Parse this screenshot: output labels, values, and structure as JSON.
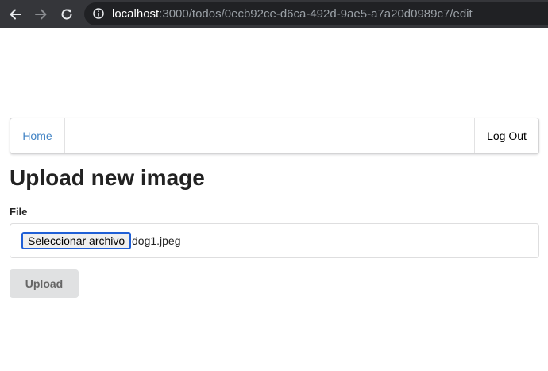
{
  "browser": {
    "url_host": "localhost",
    "url_path": ":3000/todos/0ecb92ce-d6ca-492d-9ae5-a7a20d0989c7/edit"
  },
  "navbar": {
    "home_label": "Home",
    "logout_label": "Log Out"
  },
  "page": {
    "title": "Upload new image"
  },
  "form": {
    "file_label": "File",
    "file_button_label": "Seleccionar archivo",
    "file_name": "dog1.jpeg",
    "submit_label": "Upload"
  },
  "colors": {
    "link": "#4183c4",
    "browser_bar": "#35363a",
    "upload_button_bg": "#e0e1e2"
  },
  "icons": [
    "back-arrow-icon",
    "forward-arrow-icon",
    "reload-icon",
    "info-icon"
  ]
}
